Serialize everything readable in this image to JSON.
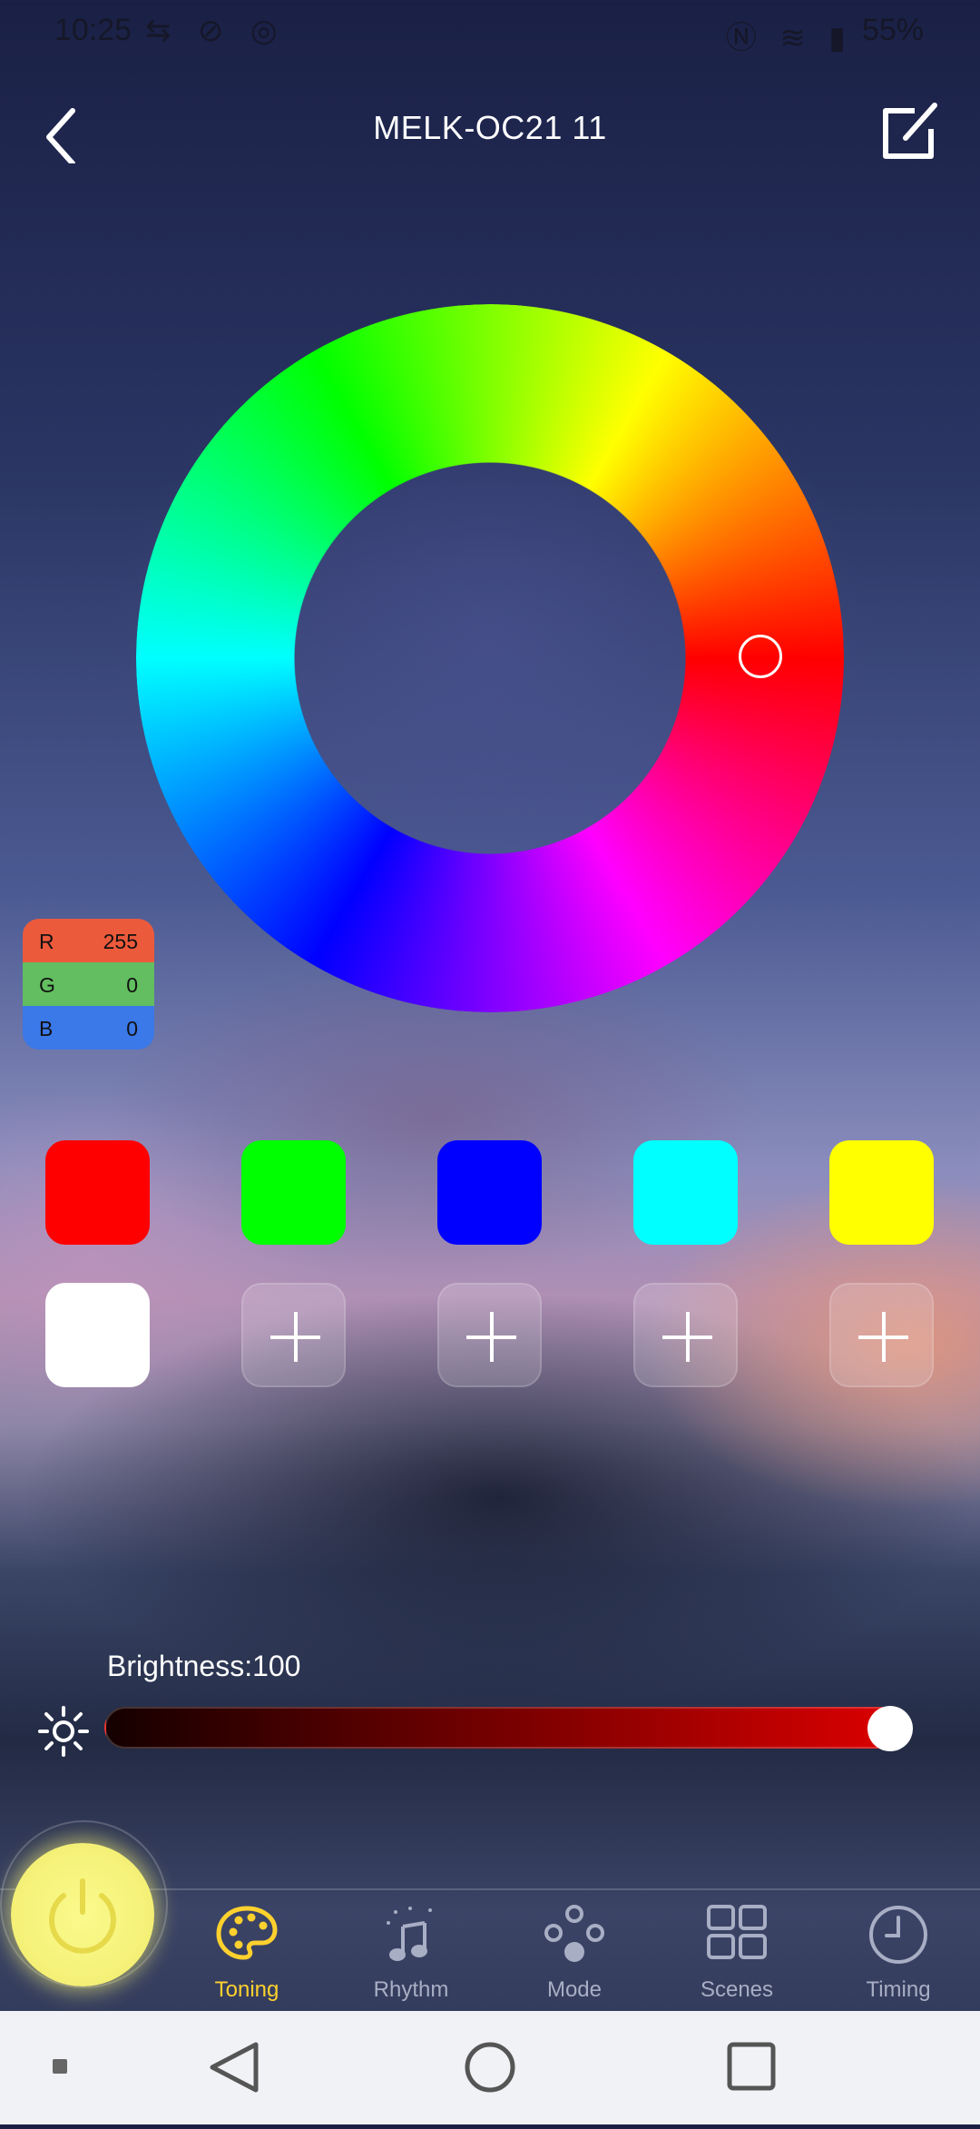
{
  "status_bar": {
    "time": "10:25",
    "left_icons": "⇆ ⊘ ◎",
    "right_icons": "Ⓝ ≋ ▮",
    "battery": "55%"
  },
  "header": {
    "title": "MELK-OC21   11"
  },
  "color_wheel": {
    "selected_hue": "red"
  },
  "rgb": {
    "r_label": "R",
    "r_value": "255",
    "g_label": "G",
    "g_value": "0",
    "b_label": "B",
    "b_value": "0",
    "r_color": "#ec5a3c",
    "g_color": "#62be60",
    "b_color": "#3b78e8"
  },
  "swatches": [
    {
      "color": "#ff0000"
    },
    {
      "color": "#00ff00"
    },
    {
      "color": "#0000ff"
    },
    {
      "color": "#00ffff"
    },
    {
      "color": "#ffff00"
    },
    {
      "color": "#ffffff"
    }
  ],
  "brightness": {
    "label": "Brightness:100",
    "value": 100
  },
  "tabs": [
    {
      "label": "Toning",
      "icon": "palette-icon",
      "active": true
    },
    {
      "label": "Rhythm",
      "icon": "music-note-icon",
      "active": false
    },
    {
      "label": "Mode",
      "icon": "mode-dots-icon",
      "active": false
    },
    {
      "label": "Scenes",
      "icon": "grid-icon",
      "active": false
    },
    {
      "label": "Timing",
      "icon": "clock-icon",
      "active": false
    }
  ],
  "colors": {
    "accent": "#ffd12e",
    "power": "#f6f27a",
    "inactive_tab": "#a8aec4"
  }
}
